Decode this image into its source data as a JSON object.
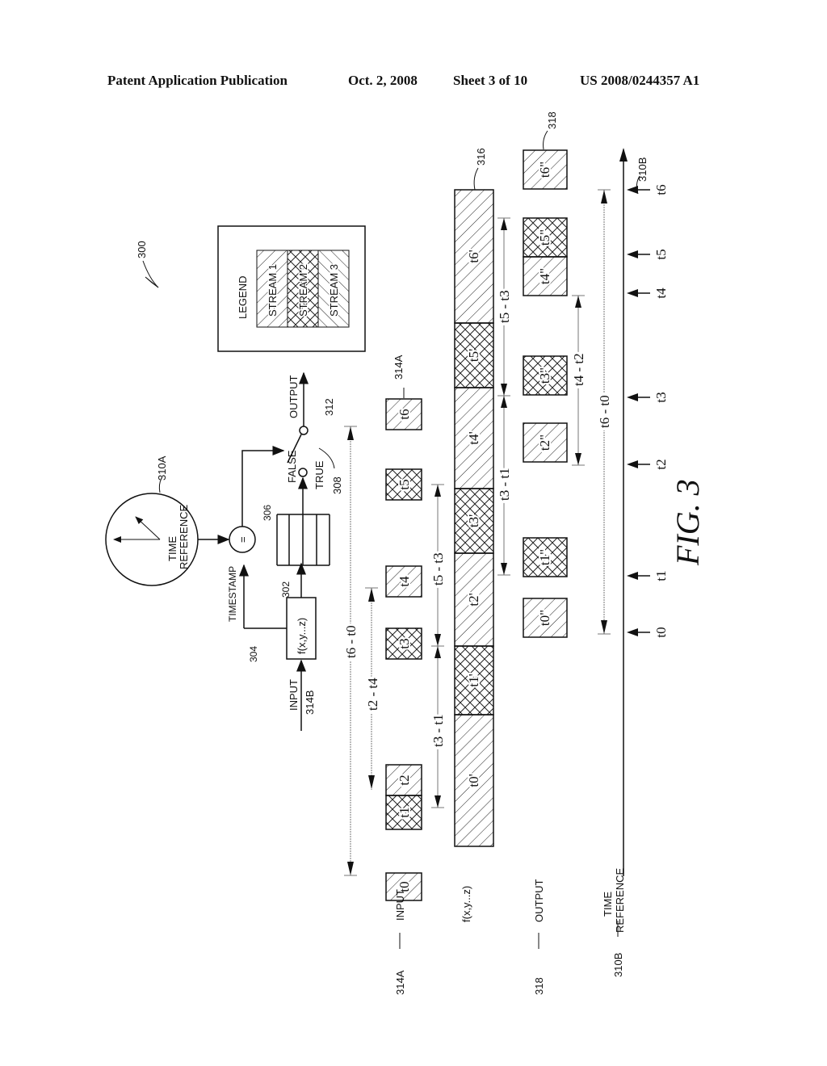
{
  "header": {
    "publication": "Patent Application Publication",
    "date": "Oct. 2, 2008",
    "sheet": "Sheet 3 of 10",
    "number": "US 2008/0244357 A1"
  },
  "figure": {
    "caption": "FIG. 3",
    "ref_main": "300",
    "legend": {
      "title": "LEGEND",
      "items": [
        "STREAM 1",
        "STREAM 2",
        "STREAM 3"
      ]
    },
    "block_diagram": {
      "clock_label_1": "TIME",
      "clock_label_2": "REFERENCE",
      "clock_ref": "310A",
      "comparator": "=",
      "timestamp_label": "TIMESTAMP",
      "timestamp_ref": "304",
      "function_label": "f(x,y...z)",
      "function_ref": "302",
      "buffer_ref": "306",
      "input_label": "INPUT",
      "input_ref": "314B",
      "switch_false": "FALSE",
      "switch_true": "TRUE",
      "switch_ref": "308",
      "output_label": "OUTPUT",
      "output_ref": "312"
    },
    "rows": {
      "input": {
        "ref": "314A",
        "label": "INPUT"
      },
      "function": {
        "label": "f(x,y...z)",
        "ref": "316"
      },
      "output": {
        "ref": "318",
        "label": "OUTPUT"
      },
      "time": {
        "ref": "310B",
        "label_1": "TIME",
        "label_2": "REFERENCE"
      }
    },
    "input_packets": [
      "t0",
      "t1",
      "t2",
      "t3",
      "t4",
      "t5",
      "t6"
    ],
    "function_segments": [
      "t0'",
      "t1'",
      "t2'",
      "t3'",
      "t4'",
      "t5'",
      "t6'"
    ],
    "output_packets": [
      "t0\"",
      "t1\"",
      "t2\"",
      "t3\"",
      "t4\"",
      "t5\"",
      "t6\""
    ],
    "time_ticks": [
      "t0",
      "t1",
      "t2",
      "t3",
      "t4",
      "t5",
      "t6"
    ],
    "intervals": {
      "input_total": "t6 - t0",
      "input_gap": "t2 - t4",
      "func_a": "t3 - t1",
      "func_b": "t5 - t3",
      "func_c": "t3 - t1",
      "func_d": "t5 - t3",
      "output_gap": "t4 - t2",
      "time_total": "t6 - t0"
    }
  }
}
